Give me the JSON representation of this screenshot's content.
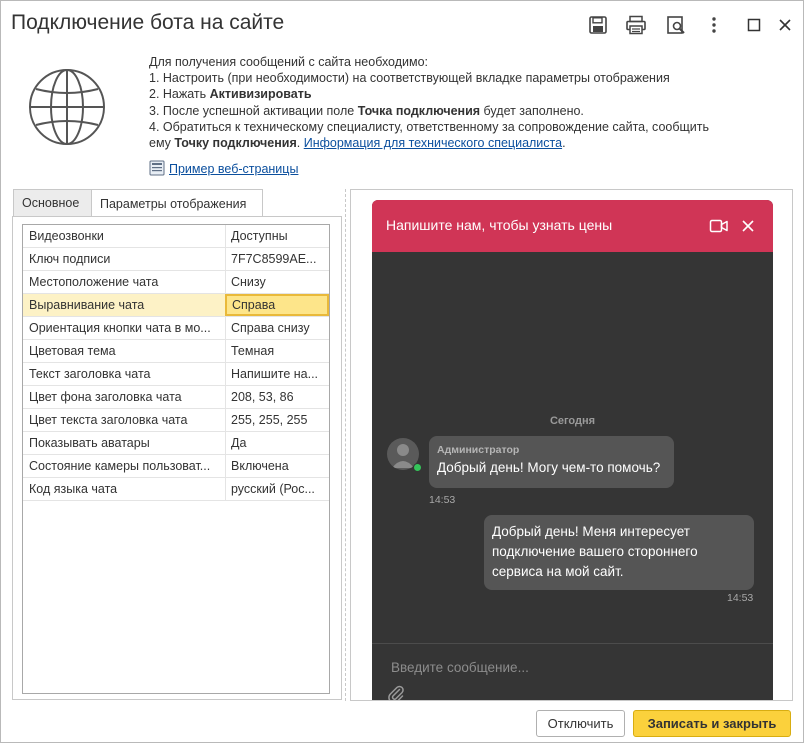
{
  "window": {
    "title": "Подключение бота на сайте",
    "icons": [
      "save-icon",
      "print-icon",
      "preview-icon",
      "more-icon",
      "maximize-icon",
      "close-icon"
    ]
  },
  "info": {
    "line1": "Для получения сообщений с сайта необходимо:",
    "line2_pre": "1. Настроить (при необходимости) на соответствующей вкладке параметры отображения",
    "line3_pre": "2. Нажать ",
    "line3_bold": "Активизировать",
    "line4_pre": "3. После успешной активации поле ",
    "line4_bold": "Точка подключения",
    "line4_post": " будет заполнено.",
    "line5_pre": "4. Обратиться к техническому специалисту, ответственному за сопровождение сайта, сообщить",
    "line6_pre": "ему ",
    "line6_bold": "Точку подключения",
    "line6_sep": ". ",
    "line6_link": "Информация для технического специалиста",
    "line6_post": ".",
    "example_link": "Пример веб-страницы"
  },
  "tabs": [
    {
      "label": "Основное",
      "active": false
    },
    {
      "label": "Параметры отображения",
      "active": true
    }
  ],
  "params": [
    {
      "name": "Видеозвонки",
      "value": "Доступны"
    },
    {
      "name": "Ключ подписи",
      "value": "7F7C8599AE..."
    },
    {
      "name": "Местоположение чата",
      "value": "Снизу"
    },
    {
      "name": "Выравнивание чата",
      "value": "Справа",
      "selected": true
    },
    {
      "name": "Ориентация кнопки чата в мо...",
      "value": "Справа снизу"
    },
    {
      "name": "Цветовая тема",
      "value": "Темная"
    },
    {
      "name": "Текст заголовка чата",
      "value": "Напишите на..."
    },
    {
      "name": "Цвет фона заголовка чата",
      "value": "208, 53, 86"
    },
    {
      "name": "Цвет текста заголовка чата",
      "value": "255, 255, 255"
    },
    {
      "name": "Показывать аватары",
      "value": "Да"
    },
    {
      "name": "Состояние камеры пользоват...",
      "value": "Включена"
    },
    {
      "name": "Код языка чата",
      "value": "русский (Рос..."
    }
  ],
  "chat": {
    "header_title": "Напишите нам, чтобы узнать цены",
    "header_bg": "#d03556",
    "header_fg": "#ffffff",
    "day_label": "Сегодня",
    "incoming": {
      "author": "Администратор",
      "text": "Добрый день! Могу чем-то помочь?",
      "time": "14:53"
    },
    "outgoing": {
      "line1": "Добрый день! Меня интересует",
      "line2": "подключение вашего стороннего",
      "line3": "сервиса на мой сайт.",
      "time": "14:53"
    },
    "input_placeholder": "Введите сообщение..."
  },
  "buttons": {
    "disconnect": "Отключить",
    "save_close": "Записать и закрыть"
  }
}
